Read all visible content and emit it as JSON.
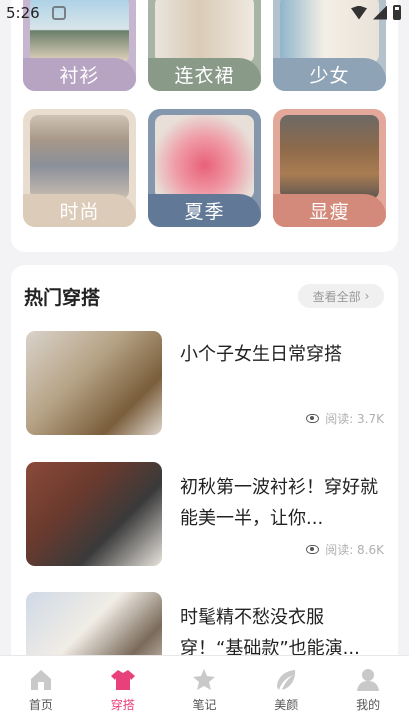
{
  "status": {
    "time": "5:26"
  },
  "categories": [
    {
      "label": "衬衫",
      "color": "#b7a3c2"
    },
    {
      "label": "连衣裙",
      "color": "#8a9a88"
    },
    {
      "label": "少女",
      "color": "#8ea3b5"
    },
    {
      "label": "时尚",
      "color": "#dccbb8"
    },
    {
      "label": "夏季",
      "color": "#617896"
    },
    {
      "label": "显瘦",
      "color": "#d38a7a"
    }
  ],
  "hot": {
    "title": "热门穿搭",
    "see_all": "查看全部",
    "articles": [
      {
        "title": "小个子女生日常穿搭",
        "views": "阅读: 3.7K"
      },
      {
        "title": "初秋第一波衬衫！穿好就能美一半，让你...",
        "views": "阅读: 8.6K"
      },
      {
        "title": "时髦精不愁没衣服穿！“基础款”也能演...",
        "views": ""
      }
    ]
  },
  "tabs": [
    {
      "label": "首页",
      "icon": "home-icon"
    },
    {
      "label": "穿搭",
      "icon": "outfit-icon"
    },
    {
      "label": "笔记",
      "icon": "note-icon"
    },
    {
      "label": "美颜",
      "icon": "beauty-icon"
    },
    {
      "label": "我的",
      "icon": "profile-icon"
    }
  ],
  "accent": "#e8407a"
}
